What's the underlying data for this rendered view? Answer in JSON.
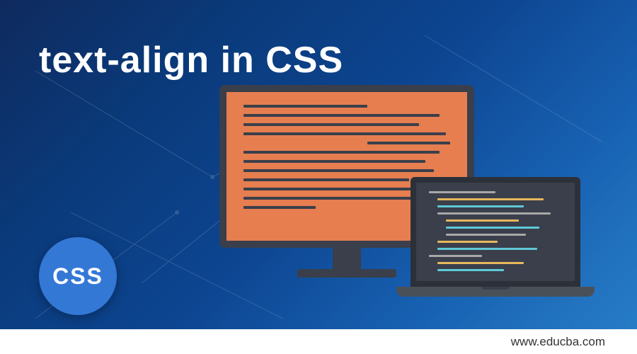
{
  "title": "text-align in CSS",
  "badge": {
    "text": "CSS"
  },
  "footer": {
    "url": "www.educba.com"
  }
}
